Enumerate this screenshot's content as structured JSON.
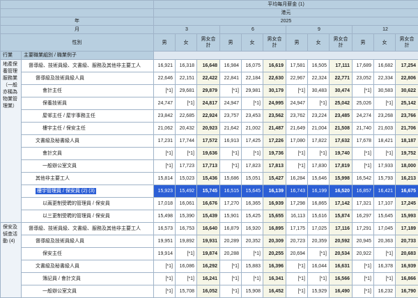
{
  "header": {
    "title": "平均每月薪金 (1)",
    "unit": "港元",
    "year_label": "年",
    "year": "2025",
    "month_label": "月",
    "months": [
      "3",
      "6",
      "9",
      "12"
    ],
    "sex_label": "性別",
    "sex_cols": [
      "男",
      "女",
      "男女合計"
    ]
  },
  "dimension_labels": {
    "industry": "行業",
    "occupation": "主要職業組別 / 職業例子"
  },
  "categories": [
    {
      "label": "地產保養管理服務業（一般亦稱為物業管理業）"
    },
    {
      "label": "保安及偵查活動 (4)"
    }
  ],
  "rows": [
    {
      "label": "督導級、技術員級、文書級、服務及其他非主要工人",
      "v": [
        "16,921",
        "16,318",
        "16,648",
        "16,984",
        "16,075",
        "16,619",
        "17,581",
        "16,505",
        "17,111",
        "17,689",
        "16,682",
        "17,254"
      ]
    },
    {
      "label": "督導級及技術員級人員",
      "v": [
        "22,646",
        "22,151",
        "22,422",
        "22,841",
        "22,184",
        "22,630",
        "22,967",
        "22,324",
        "22,771",
        "23,052",
        "22,334",
        "22,806"
      ]
    },
    {
      "label": "會計主任",
      "v": [
        "[*1]",
        "29,681",
        "29,879",
        "[*1]",
        "29,981",
        "30,179",
        "[*1]",
        "30,483",
        "30,474",
        "[*1]",
        "30,583",
        "30,622"
      ]
    },
    {
      "label": "保養技術員",
      "v": [
        "24,747",
        "[*1]",
        "24,817",
        "24,947",
        "[*1]",
        "24,995",
        "24,947",
        "[*1]",
        "25,042",
        "25,026",
        "[*1]",
        "25,142"
      ]
    },
    {
      "label": "屋邨主任 / 屋宇事務主任",
      "v": [
        "23,842",
        "22,685",
        "22,924",
        "23,757",
        "23,453",
        "23,562",
        "23,762",
        "23,224",
        "23,485",
        "24,274",
        "23,268",
        "23,766"
      ]
    },
    {
      "label": "樓宇主任 / 保安主任",
      "v": [
        "21,062",
        "20,432",
        "20,923",
        "21,642",
        "21,002",
        "21,487",
        "21,649",
        "21,004",
        "21,508",
        "21,740",
        "21,603",
        "21,706"
      ]
    },
    {
      "label": "文書級及秘書級人員",
      "v": [
        "17,231",
        "17,744",
        "17,572",
        "16,913",
        "17,425",
        "17,226",
        "17,080",
        "17,822",
        "17,632",
        "17,678",
        "18,421",
        "18,187"
      ]
    },
    {
      "label": "會計文員",
      "v": [
        "[*1]",
        "[*1]",
        "19,636",
        "[*1]",
        "[*1]",
        "19,736",
        "[*1]",
        "[*1]",
        "19,740",
        "[*1]",
        "[*1]",
        "19,752"
      ]
    },
    {
      "label": "一般辦公室文員",
      "v": [
        "[*1]",
        "17,723",
        "17,713",
        "[*1]",
        "17,823",
        "17,813",
        "[*1]",
        "17,830",
        "17,819",
        "[*1]",
        "17,933",
        "18,000"
      ]
    },
    {
      "label": "其他非主要工人",
      "v": [
        "15,814",
        "15,023",
        "15,436",
        "15,686",
        "15,051",
        "15,427",
        "16,284",
        "15,646",
        "15,998",
        "16,542",
        "15,793",
        "16,213"
      ]
    },
    {
      "label": "樓宇管理員 / 保安員 (2) (3)",
      "v": [
        "15,923",
        "15,492",
        "15,745",
        "16,515",
        "15,645",
        "16,139",
        "16,743",
        "16,199",
        "16,520",
        "16,857",
        "16,421",
        "16,675"
      ]
    },
    {
      "label": "以兩更制受聘的管理員 / 保安員",
      "v": [
        "17,018",
        "16,061",
        "16,676",
        "17,270",
        "16,365",
        "16,939",
        "17,298",
        "16,865",
        "17,142",
        "17,321",
        "17,107",
        "17,245"
      ]
    },
    {
      "label": "以三更制受聘的管理員 / 保安員",
      "v": [
        "15,498",
        "15,390",
        "15,439",
        "15,901",
        "15,425",
        "15,655",
        "16,113",
        "15,616",
        "15,874",
        "16,297",
        "15,645",
        "15,993"
      ]
    },
    {
      "label": "督導級、技術員級、文書級、服務及其他非主要工人",
      "v": [
        "16,573",
        "16,753",
        "16,640",
        "16,879",
        "16,920",
        "16,895",
        "17,175",
        "17,025",
        "17,116",
        "17,291",
        "17,045",
        "17,189"
      ]
    },
    {
      "label": "督導級及技術員級人員",
      "v": [
        "19,951",
        "19,892",
        "19,931",
        "20,289",
        "20,352",
        "20,309",
        "20,723",
        "20,359",
        "20,592",
        "20,945",
        "20,363",
        "20,733"
      ]
    },
    {
      "label": "保安主任",
      "v": [
        "19,914",
        "[*1]",
        "19,874",
        "20,288",
        "[*1]",
        "20,255",
        "20,694",
        "[*1]",
        "20,534",
        "20,922",
        "[*1]",
        "20,683"
      ]
    },
    {
      "label": "文書級及秘書級人員",
      "v": [
        "[*1]",
        "16,086",
        "16,292",
        "[*1]",
        "15,883",
        "16,396",
        "[*1]",
        "16,044",
        "16,631",
        "[*1]",
        "16,378",
        "16,939"
      ]
    },
    {
      "label": "簿記員 / 會計文員",
      "v": [
        "[*1]",
        "[*1]",
        "16,241",
        "[*1]",
        "[*1]",
        "16,341",
        "[*1]",
        "[*1]",
        "16,566",
        "[*1]",
        "[*1]",
        "16,866"
      ]
    },
    {
      "label": "一般辦公室文員",
      "v": [
        "[*1]",
        "15,708",
        "16,052",
        "[*1]",
        "15,908",
        "16,452",
        "[*1]",
        "15,929",
        "16,490",
        "[*1]",
        "16,232",
        "16,790"
      ]
    }
  ],
  "colors": {
    "header_bg": "#b8cfe0",
    "selection": "#2c5fd6",
    "footnote_text": "#4f8a2c"
  }
}
